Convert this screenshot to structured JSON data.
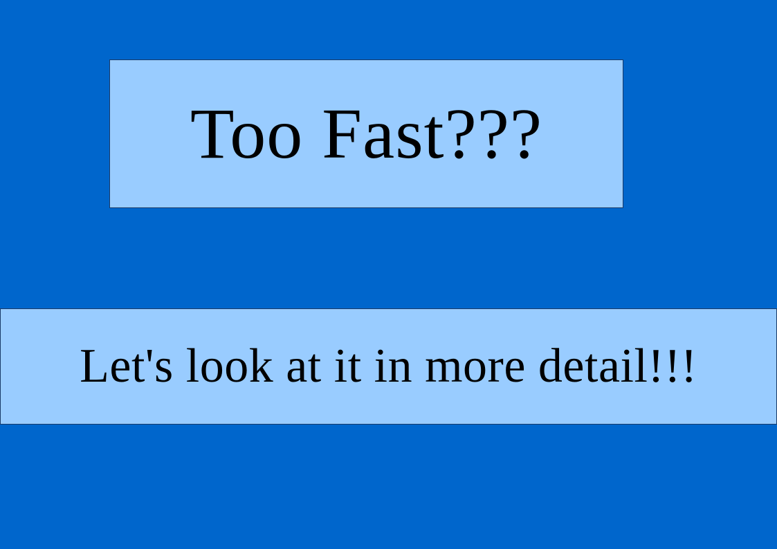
{
  "slide": {
    "title": "Too Fast???",
    "subtitle": "Let's look at it in more detail!!!"
  },
  "colors": {
    "background": "#0066cc",
    "box_fill": "#99ccff",
    "text": "#000000"
  }
}
